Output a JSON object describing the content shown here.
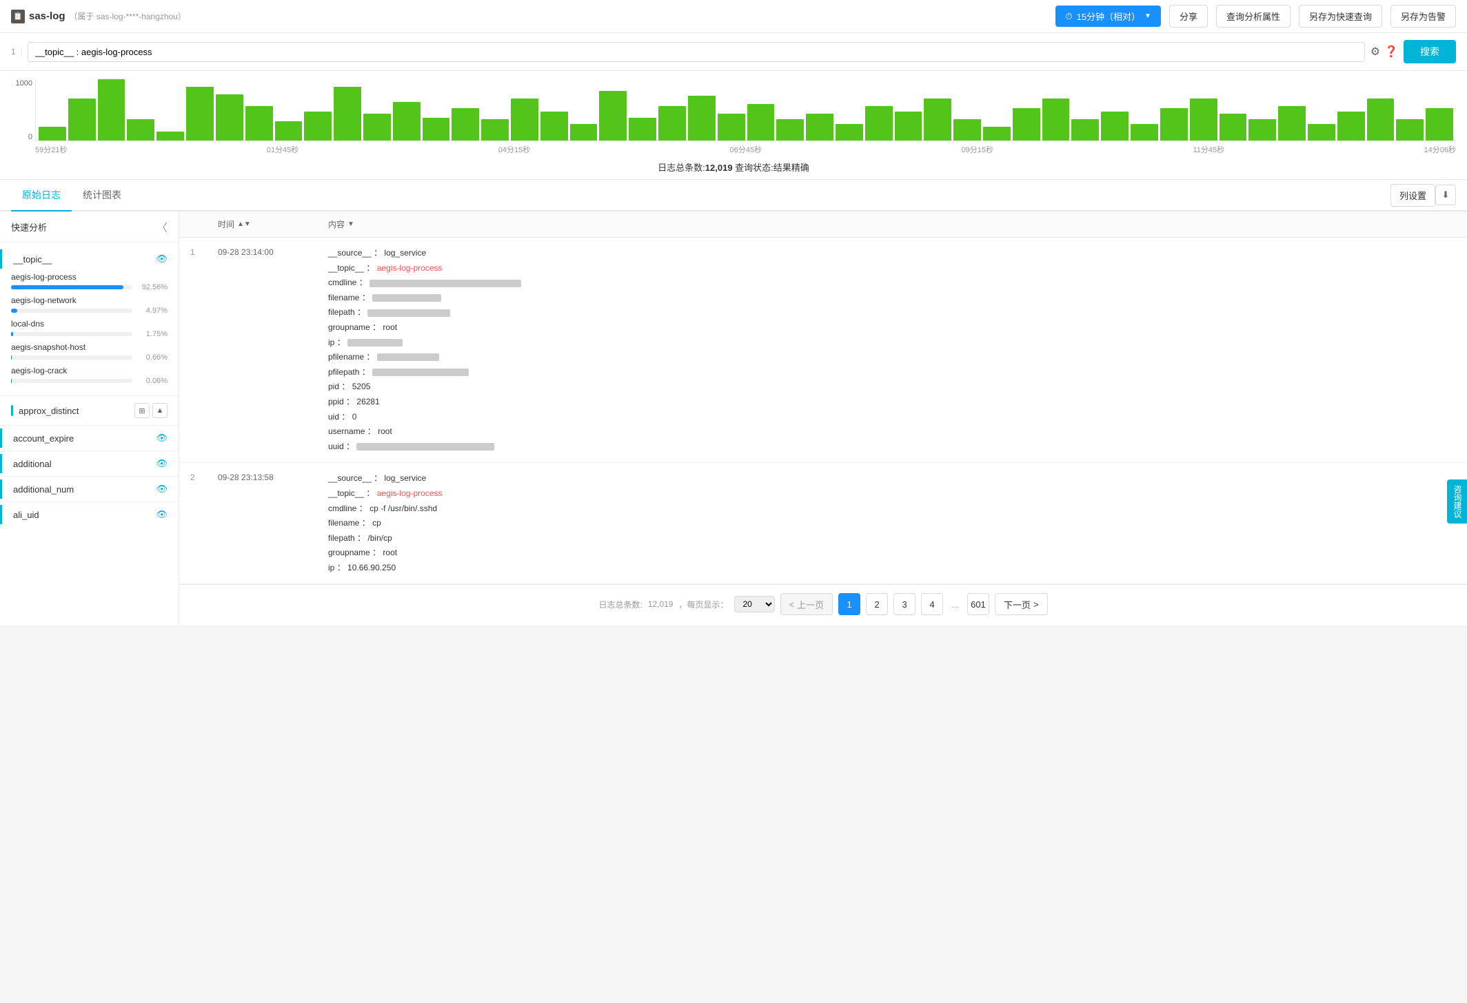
{
  "header": {
    "logo": "sas-log",
    "logo_subtitle": "（属于 sas-log-****-hangzhou）",
    "time_btn": "15分钟（相对）",
    "share_btn": "分享",
    "query_attr_btn": "查询分析属性",
    "save_query_btn": "另存为快速查询",
    "save_alert_btn": "另存为告警"
  },
  "search": {
    "line_num": "1",
    "query_text": "__topic__ : aegis-log-process",
    "search_btn": "搜索"
  },
  "chart": {
    "y_max": "1000",
    "y_min": "0",
    "bars": [
      18,
      55,
      80,
      28,
      12,
      70,
      60,
      45,
      25,
      38,
      70,
      35,
      50,
      30,
      42,
      28,
      55,
      38,
      22,
      65,
      30,
      45,
      58,
      35,
      48,
      28,
      35,
      22,
      45,
      38,
      55,
      28,
      18,
      42,
      55,
      28,
      38,
      22,
      42,
      55,
      35,
      28,
      45,
      22,
      38,
      55,
      28,
      42
    ],
    "x_labels": [
      "59分21秒",
      "01分45秒",
      "04分15秒",
      "06分45秒",
      "09分15秒",
      "11分45秒",
      "14分06秒"
    ],
    "summary_count": "12,019",
    "summary_status": "结果精确",
    "summary_prefix": "日志总条数:",
    "summary_middle": " 查询状态:"
  },
  "tabs": {
    "raw_log": "原始日志",
    "stat_chart": "统计图表",
    "col_settings": "列设置"
  },
  "left_panel": {
    "title": "快速分析",
    "fields": [
      {
        "name": "__topic__",
        "values": [
          {
            "label": "aegis-log-process",
            "pct": 92.56,
            "pct_text": "92.56%"
          },
          {
            "label": "aegis-log-network",
            "pct": 4.97,
            "pct_text": "4.97%"
          },
          {
            "label": "local-dns",
            "pct": 1.75,
            "pct_text": "1.75%"
          },
          {
            "label": "aegis-snapshot-host",
            "pct": 0.66,
            "pct_text": "0.66%"
          },
          {
            "label": "aegis-log-crack",
            "pct": 0.06,
            "pct_text": "0.06%"
          }
        ]
      },
      {
        "name": "approx_distinct",
        "has_icons": true
      },
      {
        "name": "account_expire"
      },
      {
        "name": "additional"
      },
      {
        "name": "additional_num"
      },
      {
        "name": "ali_uid"
      }
    ]
  },
  "log_table": {
    "col_num": "",
    "col_time": "时间",
    "col_content": "内容",
    "entries": [
      {
        "num": "1",
        "time": "09-28 23:14:00",
        "fields": [
          {
            "key": "__source__",
            "value": "log_service",
            "highlight": false
          },
          {
            "key": "__topic__",
            "value": "aegis-log-process",
            "highlight": true
          },
          {
            "key": "cmdline",
            "value": "BLURRED_LONG",
            "blurred": true
          },
          {
            "key": "filename",
            "value": "BLURRED_MED",
            "blurred": true
          },
          {
            "key": "filepath",
            "value": "BLURRED_SHORT",
            "blurred": true
          },
          {
            "key": "groupname",
            "value": "root",
            "highlight": false
          },
          {
            "key": "ip",
            "value": "BLURRED_MED2",
            "blurred": true
          },
          {
            "key": "pfilename",
            "value": "BLURRED_MED3",
            "blurred": true
          },
          {
            "key": "pfilepath",
            "value": "BLURRED_LONG2",
            "blurred": true
          },
          {
            "key": "pid",
            "value": "5205",
            "highlight": false
          },
          {
            "key": "ppid",
            "value": "26281",
            "highlight": false
          },
          {
            "key": "uid",
            "value": "0",
            "highlight": false
          },
          {
            "key": "username",
            "value": "root",
            "highlight": false
          },
          {
            "key": "uuid",
            "value": "BLURRED_VERY_LONG",
            "blurred": true
          }
        ]
      },
      {
        "num": "2",
        "time": "09-28 23:13:58",
        "fields": [
          {
            "key": "__source__",
            "value": "log_service",
            "highlight": false
          },
          {
            "key": "__topic__",
            "value": "aegis-log-process",
            "highlight": true
          },
          {
            "key": "cmdline",
            "value": "cp -f /usr/bin/.sshd",
            "highlight": false
          },
          {
            "key": "filename",
            "value": "cp",
            "highlight": false
          },
          {
            "key": "filepath",
            "value": "/bin/cp",
            "highlight": false
          },
          {
            "key": "groupname",
            "value": "root",
            "highlight": false
          },
          {
            "key": "ip",
            "value": "10.66.90.250",
            "highlight": false
          }
        ]
      }
    ]
  },
  "pagination": {
    "total_prefix": "日志总条数:",
    "total_count": "12,019",
    "page_size_prefix": "，每页显示：",
    "page_size": "20",
    "prev_btn": "上一页",
    "next_btn": "下一页",
    "pages": [
      "1",
      "2",
      "3",
      "4",
      "...",
      "601"
    ],
    "current_page": "1"
  },
  "float_btn": {
    "label": "咨询建议"
  }
}
